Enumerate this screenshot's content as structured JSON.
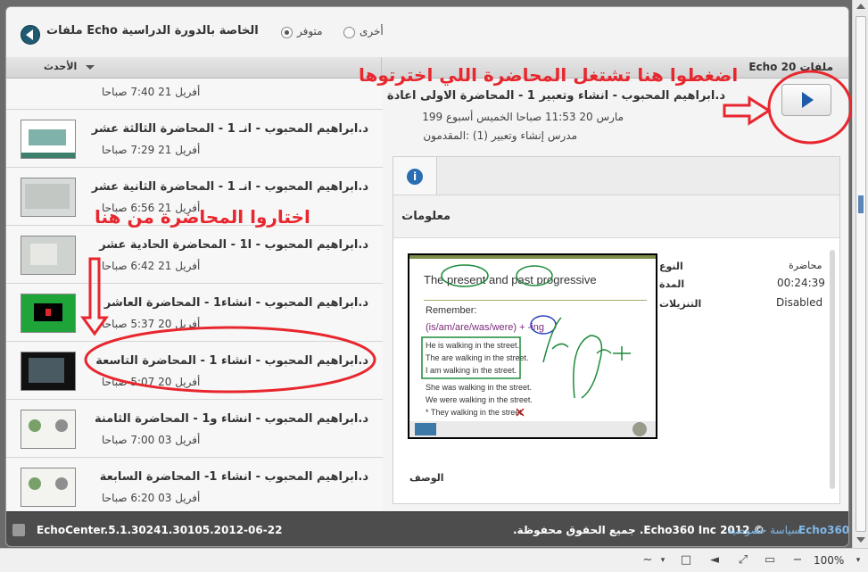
{
  "header": {
    "title": "ملفات Echo الخاصة بالدورة الدراسية",
    "filter_available": "متوفر",
    "filter_other": "أخرى"
  },
  "sort": {
    "label": "الأحدث"
  },
  "count_label": "Echo 20 ملفات",
  "list": [
    {
      "title": "",
      "date": "أفريل 21 7:40 صباحا"
    },
    {
      "title": "د.ابراهيم المحبوب - انـ 1 - المحاضرة الثالثة عشر",
      "date": "أفريل 21 7:29 صباحا"
    },
    {
      "title": "د.ابراهيم المحبوب - انـ 1 - المحاضرة الثانية عشر",
      "date": "أفريل 21 6:56 صباحا"
    },
    {
      "title": "د.ابراهيم المحبوب - ا1 - المحاضرة الحادية عشر",
      "date": "أفريل 21 6:42 صباحا"
    },
    {
      "title": "د.ابراهيم المحبوب - انشاء1 - المحاضرة العاشر",
      "date": "أفريل 20 5:37 صباحا"
    },
    {
      "title": "د.ابراهيم المحبوب - انشاء 1 - المحاضرة التاسعة",
      "date": "أفريل 20 5:07 صباحا"
    },
    {
      "title": "د.ابراهيم المحبوب - انشاء و1 - المحاضرة الثامنة",
      "date": "أفريل 03 7:00 صباحا"
    },
    {
      "title": "د.ابراهيم المحبوب - انشاء 1- المحاضرة السابعة",
      "date": "أفريل 03 6:20 صباحا"
    }
  ],
  "detail": {
    "title": "د.ابراهيم المحبوب - انشاء وتعبير 1 - المحاضرة الاولى اعادة",
    "date": "مارس 20 11:53 صباحا الخميس أسبوع 199",
    "teacher": "مدرس إنشاء وتعبير (1) :المقدمون",
    "info_heading": "معلومات",
    "type_label": "النوع",
    "type_value": "محاضرة",
    "duration_label": "المدة",
    "duration_value": "00:24:39",
    "downloads_label": "التنزيلات",
    "downloads_value": "Disabled",
    "description_label": "الوصف"
  },
  "slide": {
    "title": "The present and past progressive",
    "remember": "Remember:",
    "rule": "(is/am/are/was/were) + -ing",
    "lines": [
      "He is walking in the street.",
      "The are walking in the street.",
      "I am walking in the street.",
      "She was walking in the street.",
      "We were walking in the street.",
      "* They walking in the street."
    ]
  },
  "annotations": {
    "top": "اضغطوا هنا تشتغل المحاضرة اللي اخترتوها",
    "side": "اختاروا المحاضرة من هنا"
  },
  "footer": {
    "version": "EchoCenter.5.1.30241.30105.2012-06-22",
    "copyright": "© 2012 Echo360 Inc. جميع الحقوق محفوظة.",
    "privacy": "سياسة خصوصية",
    "brand": "Echo360"
  },
  "statusbar": {
    "zoom": "100%"
  },
  "colors": {
    "annotation": "#e8262e",
    "play": "#1d5aa8",
    "footer": "#4d4d4d"
  }
}
